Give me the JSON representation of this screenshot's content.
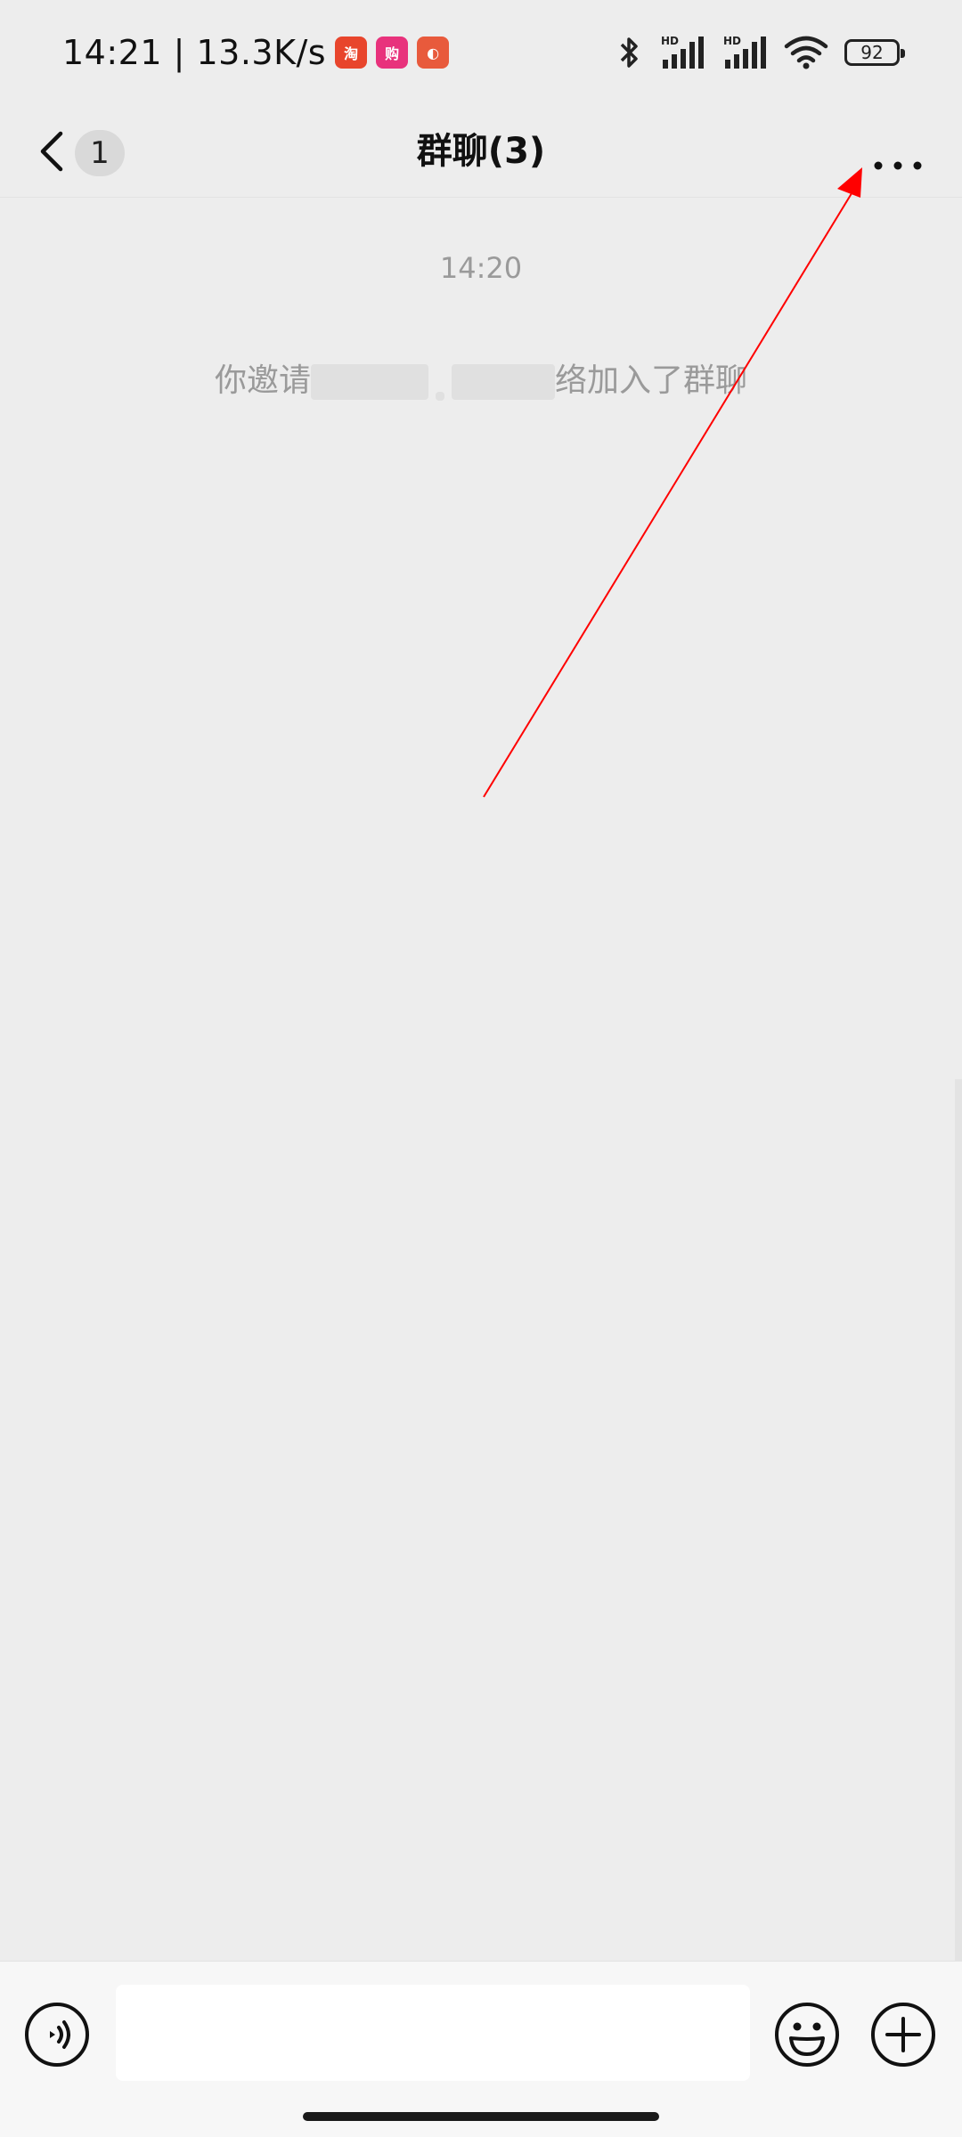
{
  "status_bar": {
    "time_speed": "14:21 | 13.3K/s",
    "app_icons": [
      {
        "name": "taobao-app-icon",
        "glyph": "淘",
        "color": "#E8452C"
      },
      {
        "name": "shopping-app-icon",
        "glyph": "购",
        "color": "#E8327C"
      },
      {
        "name": "orange-app-icon",
        "glyph": "◐",
        "color": "#E85A3C"
      }
    ],
    "signal_labels": [
      "HD",
      "HD"
    ],
    "battery": "92"
  },
  "nav": {
    "unread_count": "1",
    "title": "群聊(3)"
  },
  "chat": {
    "timestamp": "14:20",
    "system_message": {
      "prefix": "你邀请",
      "suffix": "络加入了群聊"
    }
  },
  "input_bar": {
    "placeholder": "",
    "value": ""
  },
  "colors": {
    "background": "#EDEDED",
    "annotation": "#FF0000",
    "muted_text": "#9A9A9A"
  }
}
